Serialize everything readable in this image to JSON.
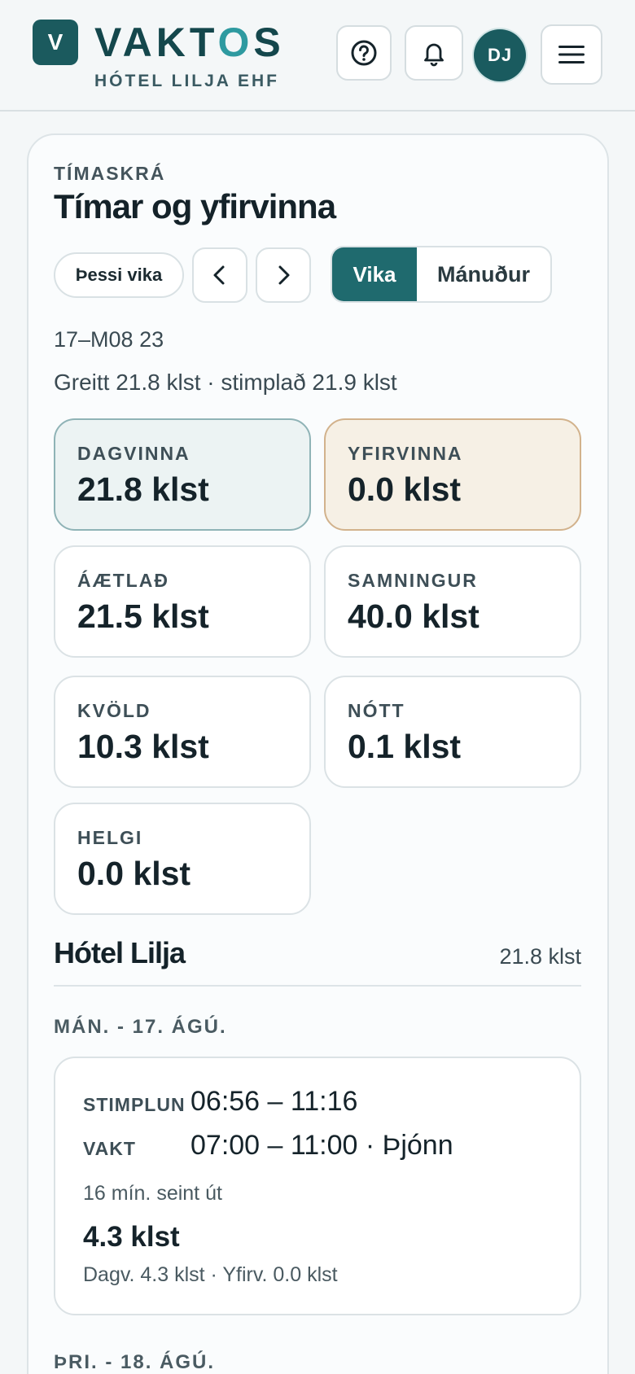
{
  "header": {
    "logo_letter": "V",
    "brand_prefix": "VAKT",
    "brand_accent": "O",
    "brand_suffix": "S",
    "subtitle": "HÓTEL LILJA EHF",
    "avatar_initials": "DJ"
  },
  "timesheet": {
    "eyebrow": "TÍMASKRÁ",
    "title": "Tímar og yfirvinna",
    "this_week_label": "Þessi vika",
    "view_week_label": "Vika",
    "view_month_label": "Mánuður",
    "date_range": "17–M08 23",
    "paid_summary": "Greitt 21.8 klst · stimplað 21.9 klst"
  },
  "stats": [
    {
      "label": "DAGVINNA",
      "value": "21.8 klst"
    },
    {
      "label": "YFIRVINNA",
      "value": "0.0 klst"
    },
    {
      "label": "ÁÆTLAÐ",
      "value": "21.5 klst"
    },
    {
      "label": "SAMNINGUR",
      "value": "40.0 klst"
    },
    {
      "label": "KVÖLD",
      "value": "10.3 klst"
    },
    {
      "label": "NÓTT",
      "value": "0.1 klst"
    },
    {
      "label": "HELGI",
      "value": "0.0 klst"
    }
  ],
  "location": {
    "name": "Hótel Lilja",
    "total": "21.8 klst"
  },
  "days": [
    {
      "label": "MÁN. - 17. ÁGÚ.",
      "punch_key": "STIMPLUN",
      "punch_value": "06:56 – 11:16",
      "shift_key": "VAKT",
      "shift_value": "07:00 – 11:00 · Þjónn",
      "note": "16 mín. seint út",
      "hours": "4.3 klst",
      "split": "Dagv. 4.3 klst · Yfirv. 0.0 klst"
    },
    {
      "label": "ÞRI. - 18. ÁGÚ."
    }
  ],
  "colors": {
    "primary": "#1f6a6e",
    "background": "#f4f7f8",
    "overtime_bg": "#f6f0e5"
  }
}
